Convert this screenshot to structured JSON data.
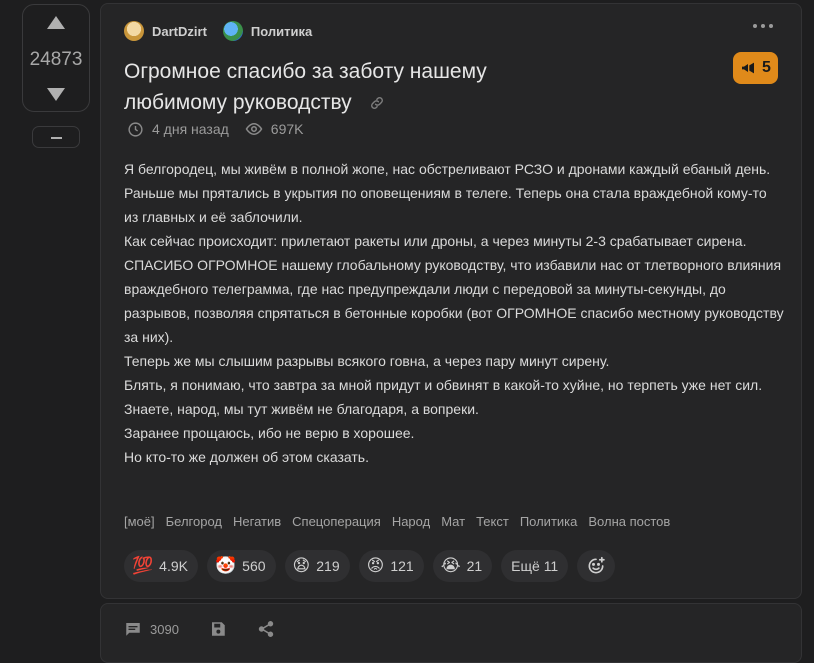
{
  "vote": {
    "count": "24873"
  },
  "post": {
    "author": "DartDzirt",
    "community": "Политика",
    "title": "Огромное спасибо за заботу нашему любимому руководству",
    "badge_count": "5",
    "time_ago": "4 дня назад",
    "views": "697K",
    "paragraphs": [
      "Я белгородец, мы живём в полной жопе, нас обстреливают РСЗО и дронами каждый ебаный день.",
      "Раньше мы прятались в укрытия по оповещениям в телеге. Теперь она стала враждебной кому-то из главных и её заблочили.",
      "Как сейчас происходит: прилетают ракеты или дроны, а через минуты 2-3 срабатывает сирена.",
      "СПАСИБО ОГРОМНОЕ нашему глобальному руководству, что избавили нас от тлетворного влияния враждебного телеграмма, где нас предупреждали люди с передовой за минуты-секунды, до разрывов, позволяя спрятаться в бетонные коробки (вот ОГРОМНОЕ спасибо местному руководству за них).",
      "Теперь же мы слышим разрывы всякого говна, а через пару минут сирену.",
      "Блять, я понимаю, что завтра за мной придут и обвинят в какой-то хуйне, но терпеть уже нет сил.",
      "Знаете, народ, мы тут живём не благодаря, а вопреки.",
      "Заранее прощаюсь, ибо не верю в хорошее.",
      "Но кто-то же должен об этом сказать."
    ],
    "tags": [
      "[моё]",
      "Белгород",
      "Негатив",
      "Спецоперация",
      "Народ",
      "Мат",
      "Текст",
      "Политика",
      "Волна постов"
    ],
    "reactions": [
      {
        "emoji": "💯",
        "count": "4.9K"
      },
      {
        "emoji": "🤡",
        "count": "560"
      },
      {
        "emoji": "😧",
        "count": "219"
      },
      {
        "emoji": "😡",
        "count": "121"
      },
      {
        "emoji": "😭",
        "count": "21"
      }
    ],
    "more_reactions": "Ещё 11",
    "comments_count": "3090"
  },
  "icons": {
    "author_avatar": "avatar",
    "community_icon": "globe-icon",
    "link": "link-icon",
    "badge": "megaphone-icon",
    "time": "clock-icon",
    "views": "eye-icon",
    "add_reaction": "smile-plus-icon",
    "comments": "comment-icon",
    "save": "save-icon",
    "share": "share-icon"
  },
  "colors": {
    "background": "#1e1e1f",
    "card": "#252526",
    "badge": "#e08a1a",
    "text": "#dadada",
    "muted": "#9b9b9b"
  }
}
